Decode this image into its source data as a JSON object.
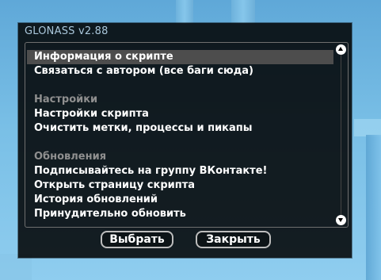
{
  "dialog": {
    "title": "GLONASS v2.88"
  },
  "menu": {
    "items": [
      {
        "label": "Информация о скрипте",
        "kind": "item",
        "selected": true
      },
      {
        "label": "Связаться с автором (все баги сюда)",
        "kind": "item"
      },
      {
        "label": "",
        "kind": "spacer"
      },
      {
        "label": "Настройки",
        "kind": "header"
      },
      {
        "label": "Настройки скрипта",
        "kind": "item"
      },
      {
        "label": "Очистить метки, процессы и пикапы",
        "kind": "item"
      },
      {
        "label": "",
        "kind": "spacer"
      },
      {
        "label": "Обновления",
        "kind": "header"
      },
      {
        "label": "Подписывайтесь на группу ВКонтакте!",
        "kind": "item"
      },
      {
        "label": "Открыть страницу скрипта",
        "kind": "item"
      },
      {
        "label": "История обновлений",
        "kind": "item"
      },
      {
        "label": "Принудительно обновить",
        "kind": "item"
      }
    ]
  },
  "buttons": {
    "select_label": "Выбрать",
    "close_label": "Закрыть"
  },
  "icons": {
    "scroll_up": "scroll-up-icon",
    "scroll_down": "scroll-down-icon"
  },
  "colors": {
    "title_text": "#a9c6da",
    "header_text": "#8f8f8f",
    "selected_row": "#4d4d4d"
  }
}
